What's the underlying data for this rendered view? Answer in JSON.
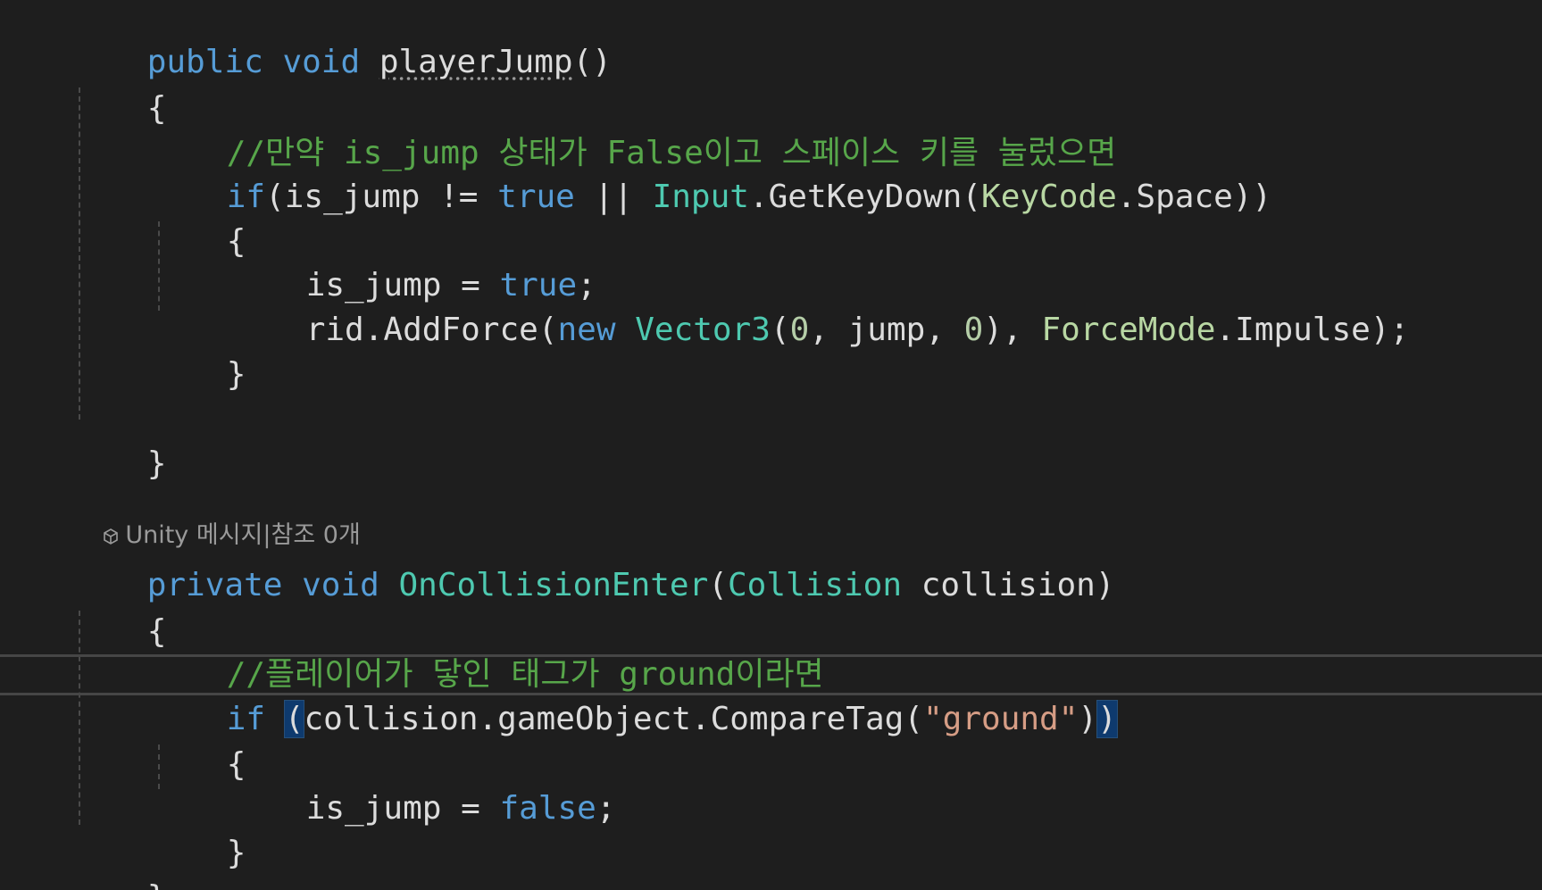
{
  "codelens": {
    "unity": "Unity 메시지",
    "separator": "|",
    "refs": "참조 0개"
  },
  "code": {
    "l1_kw1": "public",
    "l1_kw2": "void",
    "l1_name": "playerJump",
    "l1_parens": "()",
    "open_brace": "{",
    "close_brace": "}",
    "l3_comment": "//만약 is_jump 상태가 False이고 스페이스 키를 눌렀으면",
    "l4_if": "if",
    "l4_p1": "(is_jump != ",
    "l4_true": "true",
    "l4_or": " || ",
    "l4_input": "Input",
    "l4_getkey": ".GetKeyDown(",
    "l4_keycode": "KeyCode",
    "l4_space": ".Space))",
    "l6_var": "is_jump = ",
    "l6_true": "true",
    "semi": ";",
    "l7_rid": "rid.AddForce(",
    "l7_new": "new",
    "l7_vec": "Vector3",
    "l7_open": "(",
    "l7_zero1": "0",
    "l7_mid": ", jump, ",
    "l7_zero2": "0",
    "l7_close": "), ",
    "l7_forcemode": "ForceMode",
    "l7_impulse": ".Impulse);",
    "m2_kw1": "private",
    "m2_kw2": "void",
    "m2_name": "OnCollisionEnter",
    "m2_open": "(",
    "m2_type": "Collision",
    "m2_param": " collision)",
    "m2_comment": "//플레이어가 닿인 태그가 ground이라면",
    "m2_if": "if",
    "m2_paren_open": "(",
    "m2_call": "collision.gameObject.CompareTag(",
    "m2_str": "\"ground\"",
    "m2_close1": ")",
    "m2_close2": ")",
    "m2_var": "is_jump = ",
    "m2_false": "false"
  }
}
